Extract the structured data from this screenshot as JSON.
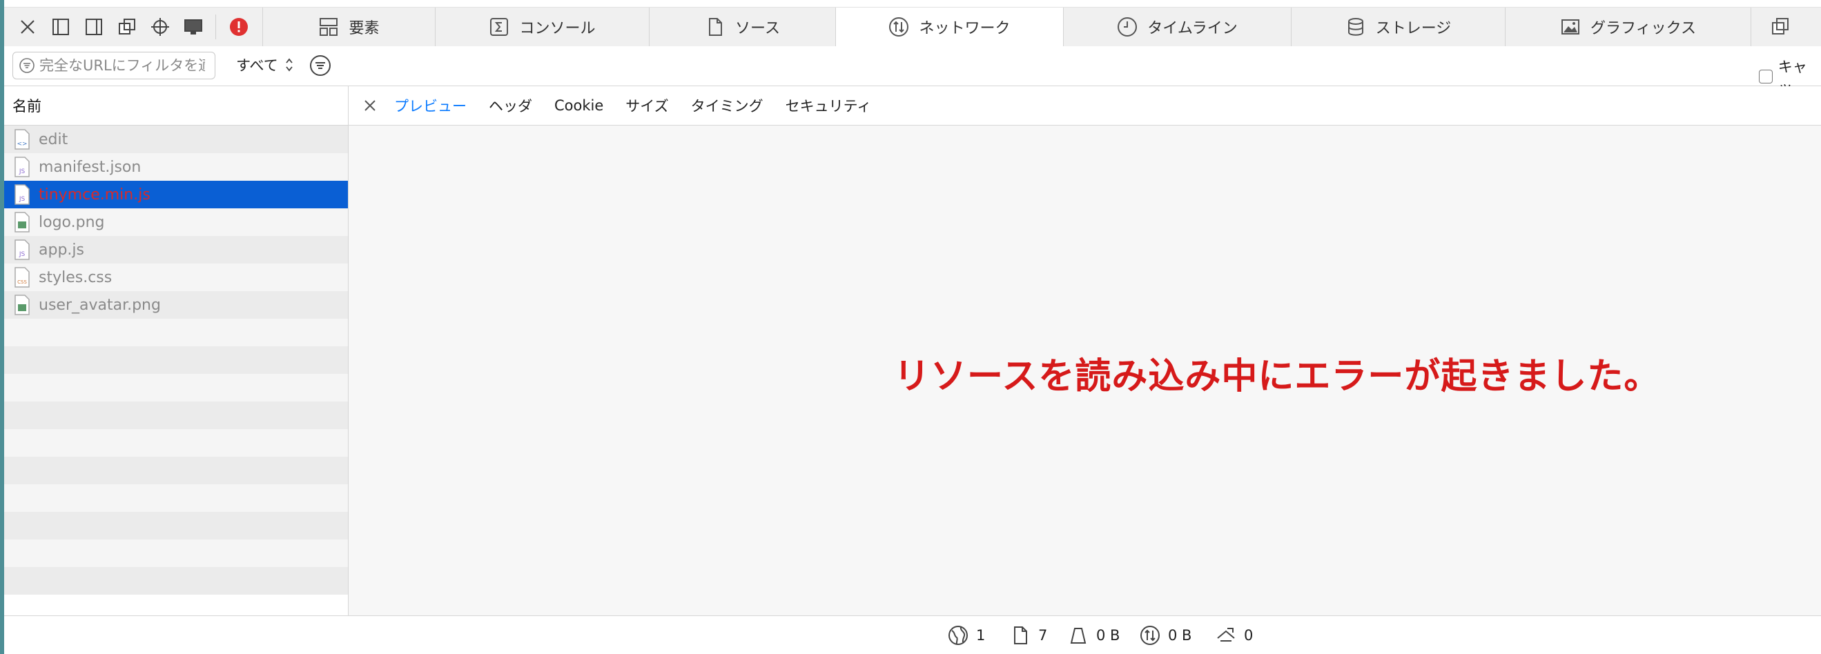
{
  "toolbar": {
    "icons": [
      "close-icon",
      "dock-bottom-icon",
      "dock-side-icon",
      "undock-icon",
      "inspect-target-icon",
      "device-icon",
      "error-icon"
    ],
    "tabs": [
      {
        "label": "要素",
        "icon": "elements-icon"
      },
      {
        "label": "コンソール",
        "icon": "console-icon"
      },
      {
        "label": "ソース",
        "icon": "sources-icon"
      },
      {
        "label": "ネットワーク",
        "icon": "network-icon",
        "active": true
      },
      {
        "label": "タイムライン",
        "icon": "timeline-icon"
      },
      {
        "label": "ストレージ",
        "icon": "storage-icon"
      },
      {
        "label": "グラフィックス",
        "icon": "graphics-icon"
      }
    ]
  },
  "filter": {
    "placeholder": "完全なURLにフィルタを適用",
    "type_selected": "すべて",
    "cache_label": "キャッ"
  },
  "list": {
    "header": "名前",
    "items": [
      {
        "name": "edit",
        "type": "html"
      },
      {
        "name": "manifest.json",
        "type": "js"
      },
      {
        "name": "tinymce.min.js",
        "type": "js",
        "selected": true
      },
      {
        "name": "logo.png",
        "type": "img"
      },
      {
        "name": "app.js",
        "type": "js"
      },
      {
        "name": "styles.css",
        "type": "css"
      },
      {
        "name": "user_avatar.png",
        "type": "img"
      }
    ]
  },
  "detail": {
    "tabs": [
      "プレビュー",
      "ヘッダ",
      "Cookie",
      "サイズ",
      "タイミング",
      "セキュリティ"
    ],
    "active_tab": "プレビュー",
    "error_message": "リソースを読み込み中にエラーが起きました。"
  },
  "status": {
    "domains": "1",
    "resources": "7",
    "transferred": "0 B",
    "size": "0 B",
    "time": "0"
  },
  "colors": {
    "selection": "#0a5fd4",
    "error": "#d61a1a",
    "accent": "#0a7aff"
  }
}
